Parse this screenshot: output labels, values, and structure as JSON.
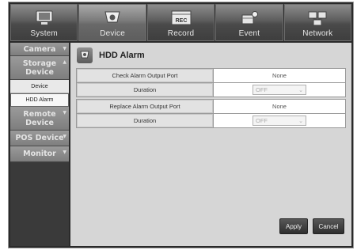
{
  "tabs": [
    {
      "label": "System",
      "icon": "monitor-icon",
      "active": false
    },
    {
      "label": "Device",
      "icon": "camera-icon",
      "active": true
    },
    {
      "label": "Record",
      "icon": "rec-icon",
      "active": false
    },
    {
      "label": "Event",
      "icon": "event-icon",
      "active": false
    },
    {
      "label": "Network",
      "icon": "network-icon",
      "active": false
    }
  ],
  "sidebar": {
    "camera": "Camera",
    "storage_device": "Storage Device",
    "sub_device": "Device",
    "sub_hdd_alarm": "HDD Alarm",
    "remote_device": "Remote Device",
    "pos_device": "POS Device",
    "monitor": "Monitor"
  },
  "page": {
    "title": "HDD Alarm",
    "title_icon": "hdd-icon"
  },
  "check_group": {
    "port_label": "Check Alarm Output Port",
    "port_value": "None",
    "duration_label": "Duration",
    "duration_value": "OFF"
  },
  "replace_group": {
    "port_label": "Replace Alarm Output Port",
    "port_value": "None",
    "duration_label": "Duration",
    "duration_value": "OFF"
  },
  "buttons": {
    "apply": "Apply",
    "cancel": "Cancel"
  },
  "colors": {
    "frame": "#2a2a2a",
    "content_bg": "#d6d6d6",
    "button_bg": "#3a3a3a"
  }
}
